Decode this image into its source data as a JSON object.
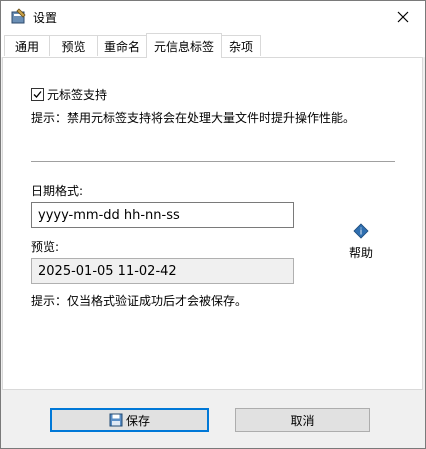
{
  "window": {
    "title": "设置",
    "close_label": "✕"
  },
  "tabs": [
    {
      "label": "通用"
    },
    {
      "label": "预览"
    },
    {
      "label": "重命名"
    },
    {
      "label": "元信息标签"
    },
    {
      "label": "杂项"
    }
  ],
  "meta": {
    "enable_label": "元标签支持",
    "enable_checked": true,
    "hint1": "提示：禁用元标签支持将会在处理大量文件时提升操作性能。",
    "date_label": "日期格式:",
    "date_value": "yyyy-mm-dd hh-nn-ss",
    "preview_label": "预览:",
    "preview_value": "2025-01-05 11-02-42",
    "hint2": "提示：仅当格式验证成功后才会被保存。",
    "help_label": "帮助"
  },
  "footer": {
    "save_label": "保存",
    "cancel_label": "取消"
  }
}
